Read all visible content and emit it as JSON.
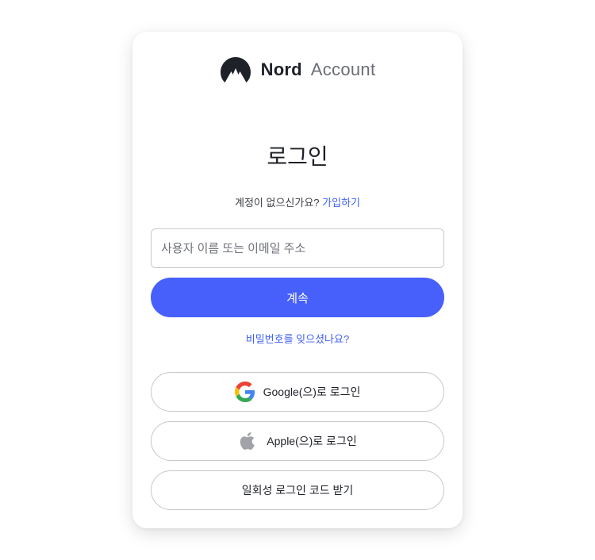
{
  "brand": {
    "name": "Nord",
    "product": "Account"
  },
  "login": {
    "title": "로그인",
    "no_account_text": "계정이 없으신가요?",
    "signup_link": "가입하기",
    "username_placeholder": "사용자 이름 또는 이메일 주소",
    "username_value": "",
    "continue_label": "계속",
    "forgot_link": "비밀번호를 잊으셨나요?"
  },
  "sso": {
    "google_label": "Google(으)로 로그인",
    "google_icon": "google-icon",
    "apple_label": "Apple(으)로 로그인",
    "apple_icon": "apple-icon",
    "otp_label": "일회성 로그인 코드 받기"
  },
  "colors": {
    "accent": "#4760fb",
    "link": "#3e5ff5",
    "text": "#1f2129",
    "border": "#c6c8cc"
  }
}
